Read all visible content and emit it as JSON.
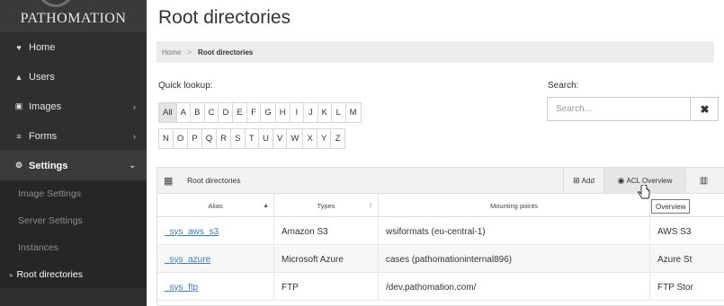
{
  "sidebar": {
    "brand": "PATHOMATION",
    "items": [
      {
        "label": "Home",
        "icon": "home-icon",
        "glyph": "♥",
        "caret": ""
      },
      {
        "label": "Users",
        "icon": "user-icon",
        "glyph": "▲",
        "caret": ""
      },
      {
        "label": "Images",
        "icon": "image-icon",
        "glyph": "▣",
        "caret": "›"
      },
      {
        "label": "Forms",
        "icon": "forms-icon",
        "glyph": "≡",
        "caret": "›"
      },
      {
        "label": "Settings",
        "icon": "cogs-icon",
        "glyph": "⚙",
        "caret": "⌄"
      }
    ],
    "subitems": [
      "Image Settings",
      "Server Settings",
      "Instances"
    ],
    "current": "Root directories"
  },
  "page": {
    "title": "Root directories",
    "breadcrumb": {
      "home": "Home",
      "separator": ">",
      "current": "Root directories"
    },
    "quick_lookup_label": "Quick lookup:",
    "search_label": "Search:",
    "search_placeholder": "Search...",
    "search_clear": "✖",
    "letters_row1": [
      "All",
      "A",
      "B",
      "C",
      "D",
      "E",
      "F",
      "G",
      "H",
      "I",
      "J",
      "K",
      "L",
      "M"
    ],
    "letters_row2": [
      "N",
      "O",
      "P",
      "Q",
      "R",
      "S",
      "T",
      "U",
      "V",
      "W",
      "X",
      "Y",
      "Z"
    ],
    "active_letter": "All"
  },
  "panel": {
    "title": "Root directories",
    "grid_glyph": "▦",
    "add_label": "Add",
    "add_glyph": "⊞",
    "acl_label": "ACL Overview",
    "acl_glyph": "◉",
    "columns_glyph": "▥",
    "tooltip": "Overview"
  },
  "table": {
    "columns": [
      {
        "label": "Alias",
        "sort": "▲"
      },
      {
        "label": "Types",
        "sort": "⇕"
      },
      {
        "label": "Mounting points",
        "sort": ""
      },
      {
        "label": "",
        "sort": ""
      }
    ],
    "rows": [
      {
        "alias": "_sys_aws_s3",
        "type": "Amazon S3",
        "mount": "wsiformats (eu-central-1)",
        "extra": "AWS S3"
      },
      {
        "alias": "_sys_azure",
        "type": "Microsoft Azure",
        "mount": "cases (pathomationinternal896)",
        "extra": "Azure St"
      },
      {
        "alias": "_sys_ftp",
        "type": "FTP",
        "mount": "/dev.pathomation.com/",
        "extra": "FTP Stor"
      }
    ]
  }
}
